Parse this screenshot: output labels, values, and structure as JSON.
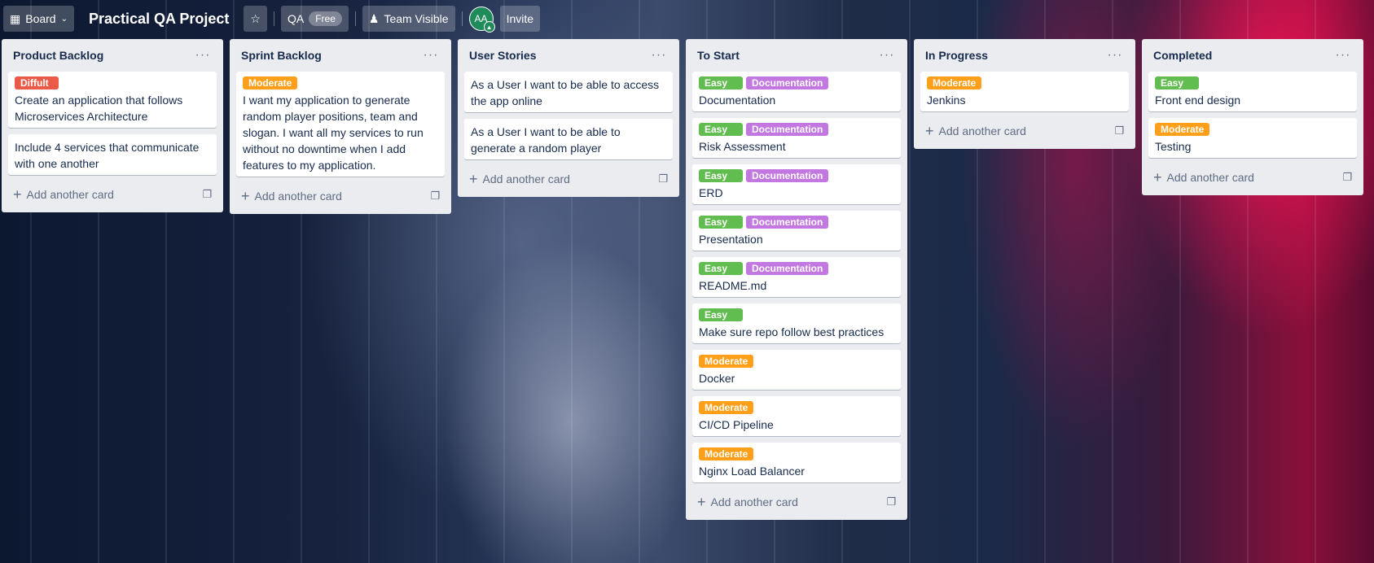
{
  "header": {
    "board_view_label": "Board",
    "board_title": "Practical QA Project",
    "workspace_name": "QA",
    "plan_badge": "Free",
    "visibility_label": "Team Visible",
    "member_initials": "AA",
    "invite_label": "Invite"
  },
  "colors": {
    "difficult": "#eb5a46",
    "moderate": "#ff9f1a",
    "easy": "#61bd4f",
    "documentation": "#c377e0"
  },
  "add_card_label": "Add another card",
  "lists": [
    {
      "title": "Product Backlog",
      "cards": [
        {
          "labels": [
            {
              "text": "Diffult",
              "color": "#eb5a46"
            }
          ],
          "text": "Create an application that follows Microservices Architecture"
        },
        {
          "labels": [],
          "text": "Include 4 services that communicate with one another"
        }
      ]
    },
    {
      "title": "Sprint Backlog",
      "cards": [
        {
          "labels": [
            {
              "text": "Moderate",
              "color": "#ff9f1a"
            }
          ],
          "text": "I want my application to generate random player positions, team and slogan. I want all my services to run without no downtime when I add features to my application."
        }
      ]
    },
    {
      "title": "User Stories",
      "cards": [
        {
          "labels": [],
          "text": "As a User I want to be able to access the app online"
        },
        {
          "labels": [],
          "text": "As a User I want to be able to generate a random player"
        }
      ]
    },
    {
      "title": "To Start",
      "cards": [
        {
          "labels": [
            {
              "text": "Easy",
              "color": "#61bd4f"
            },
            {
              "text": "Documentation",
              "color": "#c377e0"
            }
          ],
          "text": "Documentation"
        },
        {
          "labels": [
            {
              "text": "Easy",
              "color": "#61bd4f"
            },
            {
              "text": "Documentation",
              "color": "#c377e0"
            }
          ],
          "text": "Risk Assessment"
        },
        {
          "labels": [
            {
              "text": "Easy",
              "color": "#61bd4f"
            },
            {
              "text": "Documentation",
              "color": "#c377e0"
            }
          ],
          "text": "ERD"
        },
        {
          "labels": [
            {
              "text": "Easy",
              "color": "#61bd4f"
            },
            {
              "text": "Documentation",
              "color": "#c377e0"
            }
          ],
          "text": "Presentation"
        },
        {
          "labels": [
            {
              "text": "Easy",
              "color": "#61bd4f"
            },
            {
              "text": "Documentation",
              "color": "#c377e0"
            }
          ],
          "text": "README.md"
        },
        {
          "labels": [
            {
              "text": "Easy",
              "color": "#61bd4f"
            }
          ],
          "text": "Make sure repo follow best practices"
        },
        {
          "labels": [
            {
              "text": "Moderate",
              "color": "#ff9f1a"
            }
          ],
          "text": "Docker"
        },
        {
          "labels": [
            {
              "text": "Moderate",
              "color": "#ff9f1a"
            }
          ],
          "text": "CI/CD Pipeline"
        },
        {
          "labels": [
            {
              "text": "Moderate",
              "color": "#ff9f1a"
            }
          ],
          "text": "Nginx Load Balancer"
        }
      ]
    },
    {
      "title": "In Progress",
      "cards": [
        {
          "labels": [
            {
              "text": "Moderate",
              "color": "#ff9f1a"
            }
          ],
          "text": "Jenkins"
        }
      ]
    },
    {
      "title": "Completed",
      "cards": [
        {
          "labels": [
            {
              "text": "Easy",
              "color": "#61bd4f"
            }
          ],
          "text": "Front end design"
        },
        {
          "labels": [
            {
              "text": "Moderate",
              "color": "#ff9f1a"
            }
          ],
          "text": "Testing"
        }
      ]
    }
  ]
}
